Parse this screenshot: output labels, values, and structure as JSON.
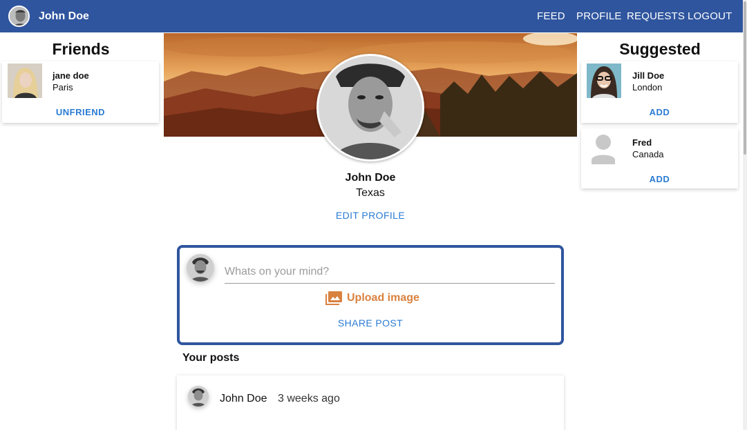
{
  "header": {
    "user_name": "John Doe",
    "nav": [
      "FEED",
      "PROFILE",
      "REQUESTS",
      "LOGOUT"
    ]
  },
  "friends": {
    "title": "Friends",
    "items": [
      {
        "name": "jane doe",
        "location": "Paris",
        "action": "UNFRIEND"
      }
    ]
  },
  "suggested": {
    "title": "Suggested",
    "items": [
      {
        "name": "Jill Doe",
        "location": "London",
        "action": "ADD"
      },
      {
        "name": "Fred",
        "location": "Canada",
        "action": "ADD"
      }
    ]
  },
  "profile": {
    "name": "John Doe",
    "location": "Texas",
    "edit_label": "EDIT PROFILE"
  },
  "composer": {
    "placeholder": "Whats on your mind?",
    "upload_label": "Upload image",
    "share_label": "SHARE POST"
  },
  "posts": {
    "heading": "Your posts",
    "items": [
      {
        "author": "John Doe",
        "time": "3 weeks ago"
      }
    ]
  },
  "colors": {
    "header_bg": "#2f559e",
    "link_blue": "#2a7bd3",
    "upload_orange": "#d9813f"
  }
}
